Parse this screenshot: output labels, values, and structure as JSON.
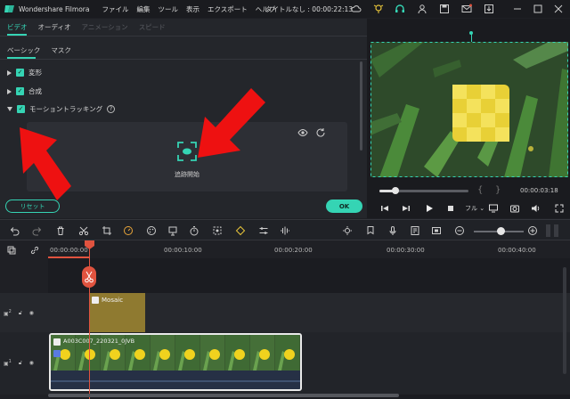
{
  "window": {
    "app_name": "Wondershare Filmora",
    "menu": [
      "ファイル",
      "編集",
      "ツール",
      "表示",
      "エクスポート",
      "ヘルプ"
    ],
    "project_title": "タイトルなし : 00:00:22:13"
  },
  "panel": {
    "tabs": [
      {
        "label": "ビデオ",
        "state": "active"
      },
      {
        "label": "オーディオ",
        "state": "normal"
      },
      {
        "label": "アニメーション",
        "state": "disabled"
      },
      {
        "label": "スピード",
        "state": "disabled"
      }
    ],
    "subtabs": [
      {
        "label": "ベーシック",
        "state": "active"
      },
      {
        "label": "マスク",
        "state": "normal"
      }
    ],
    "properties": [
      {
        "label": "変形",
        "expanded": false,
        "checked": true
      },
      {
        "label": "合成",
        "expanded": false,
        "checked": true
      },
      {
        "label": "モーショントラッキング",
        "expanded": true,
        "checked": true
      }
    ],
    "help_icon": "question-icon",
    "tracking_button_label": "追跡開始",
    "reset_label": "リセット",
    "ok_label": "OK"
  },
  "preview": {
    "timecode": "00:00:03:18",
    "progress_fraction": 0.18,
    "speed_label": "フル"
  },
  "timeline": {
    "ruler": [
      "00:00:00:00",
      "00:00:10:00",
      "00:00:20:00",
      "00:00:30:00",
      "00:00:40:00"
    ],
    "tracks": [
      {
        "index": "2",
        "clip_label": "Mosaic"
      },
      {
        "index": "1",
        "clip_label": "A003C007_220321_0JVB"
      }
    ],
    "zoom_fraction": 0.55
  },
  "colors": {
    "accent": "#35d4b4",
    "playhead": "#e0533f",
    "effect_clip": "#8f7a30",
    "annotation_arrow": "#ee1111"
  }
}
